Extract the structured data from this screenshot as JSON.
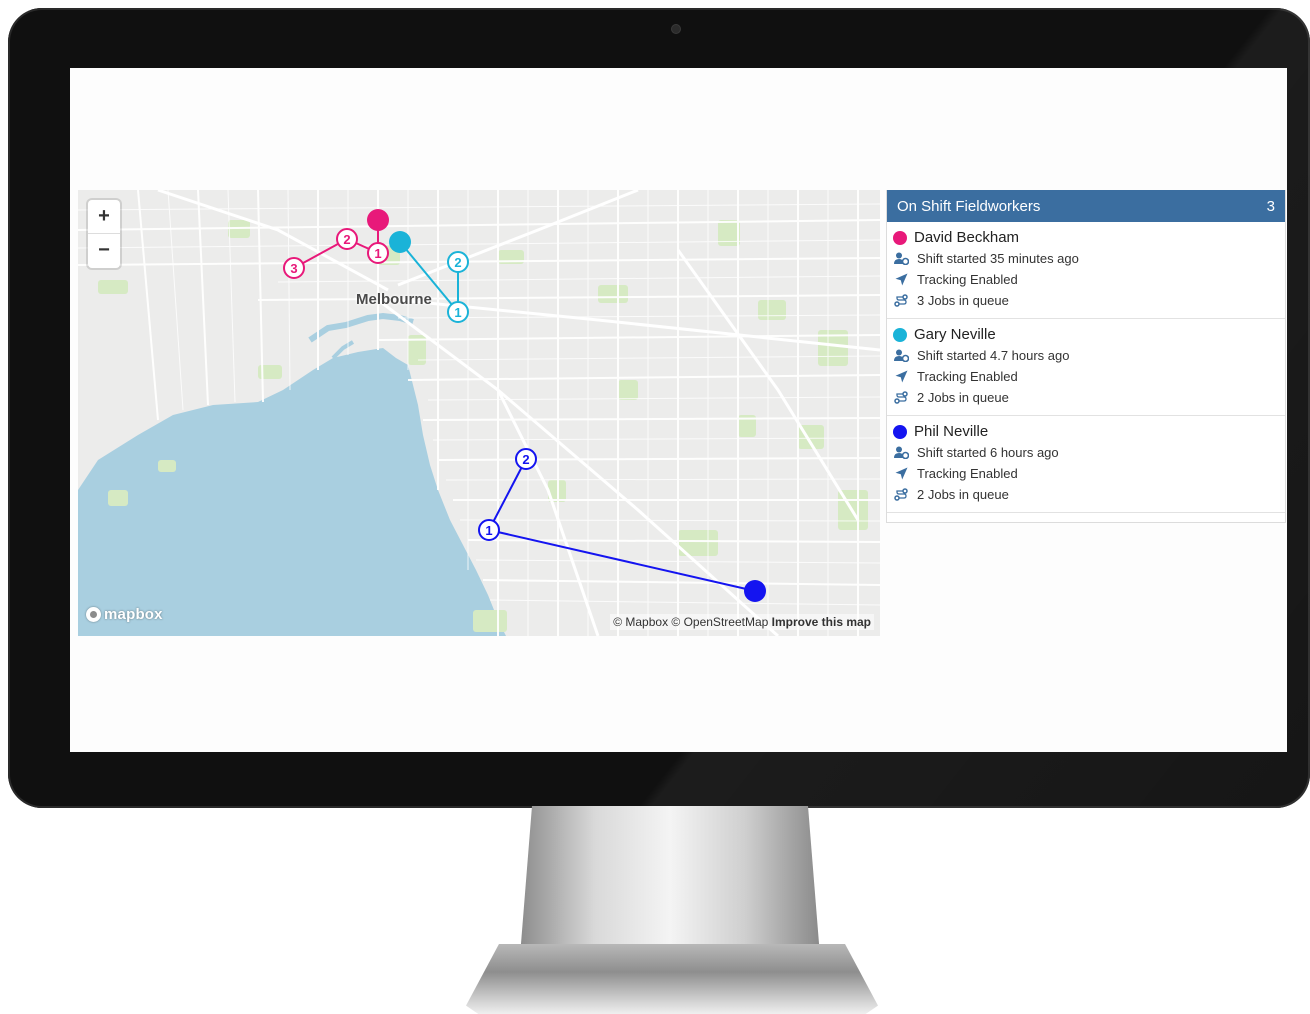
{
  "map": {
    "city_label": "Melbourne",
    "zoom_in": "+",
    "zoom_out": "−",
    "logo_text": "mapbox",
    "attribution_prefix": "© Mapbox © OpenStreetMap",
    "attribution_link": "Improve this map",
    "route_points": [
      {
        "label": "1",
        "worker": "David Beckham"
      },
      {
        "label": "2",
        "worker": "David Beckham"
      },
      {
        "label": "3",
        "worker": "David Beckham"
      },
      {
        "label": "1",
        "worker": "Gary Neville"
      },
      {
        "label": "2",
        "worker": "Gary Neville"
      },
      {
        "label": "1",
        "worker": "Phil Neville"
      },
      {
        "label": "2",
        "worker": "Phil Neville"
      }
    ]
  },
  "panel": {
    "title": "On Shift Fieldworkers",
    "count": "3",
    "workers": [
      {
        "name": "David Beckham",
        "color": "#e8197a",
        "shift": "Shift started 35 minutes ago",
        "tracking": "Tracking Enabled",
        "jobs": "3 Jobs in queue"
      },
      {
        "name": "Gary Neville",
        "color": "#1ab3d8",
        "shift": "Shift started 4.7 hours ago",
        "tracking": "Tracking Enabled",
        "jobs": "2 Jobs in queue"
      },
      {
        "name": "Phil Neville",
        "color": "#1414f0",
        "shift": "Shift started 6 hours ago",
        "tracking": "Tracking Enabled",
        "jobs": "2 Jobs in queue"
      }
    ]
  },
  "icons": {
    "user": "user-clock-icon",
    "tracking": "location-arrow-icon",
    "jobs": "route-icon"
  },
  "colors": {
    "panel_header": "#3b6ea0",
    "water": "#a9cfe0",
    "park": "#d6eac3"
  }
}
